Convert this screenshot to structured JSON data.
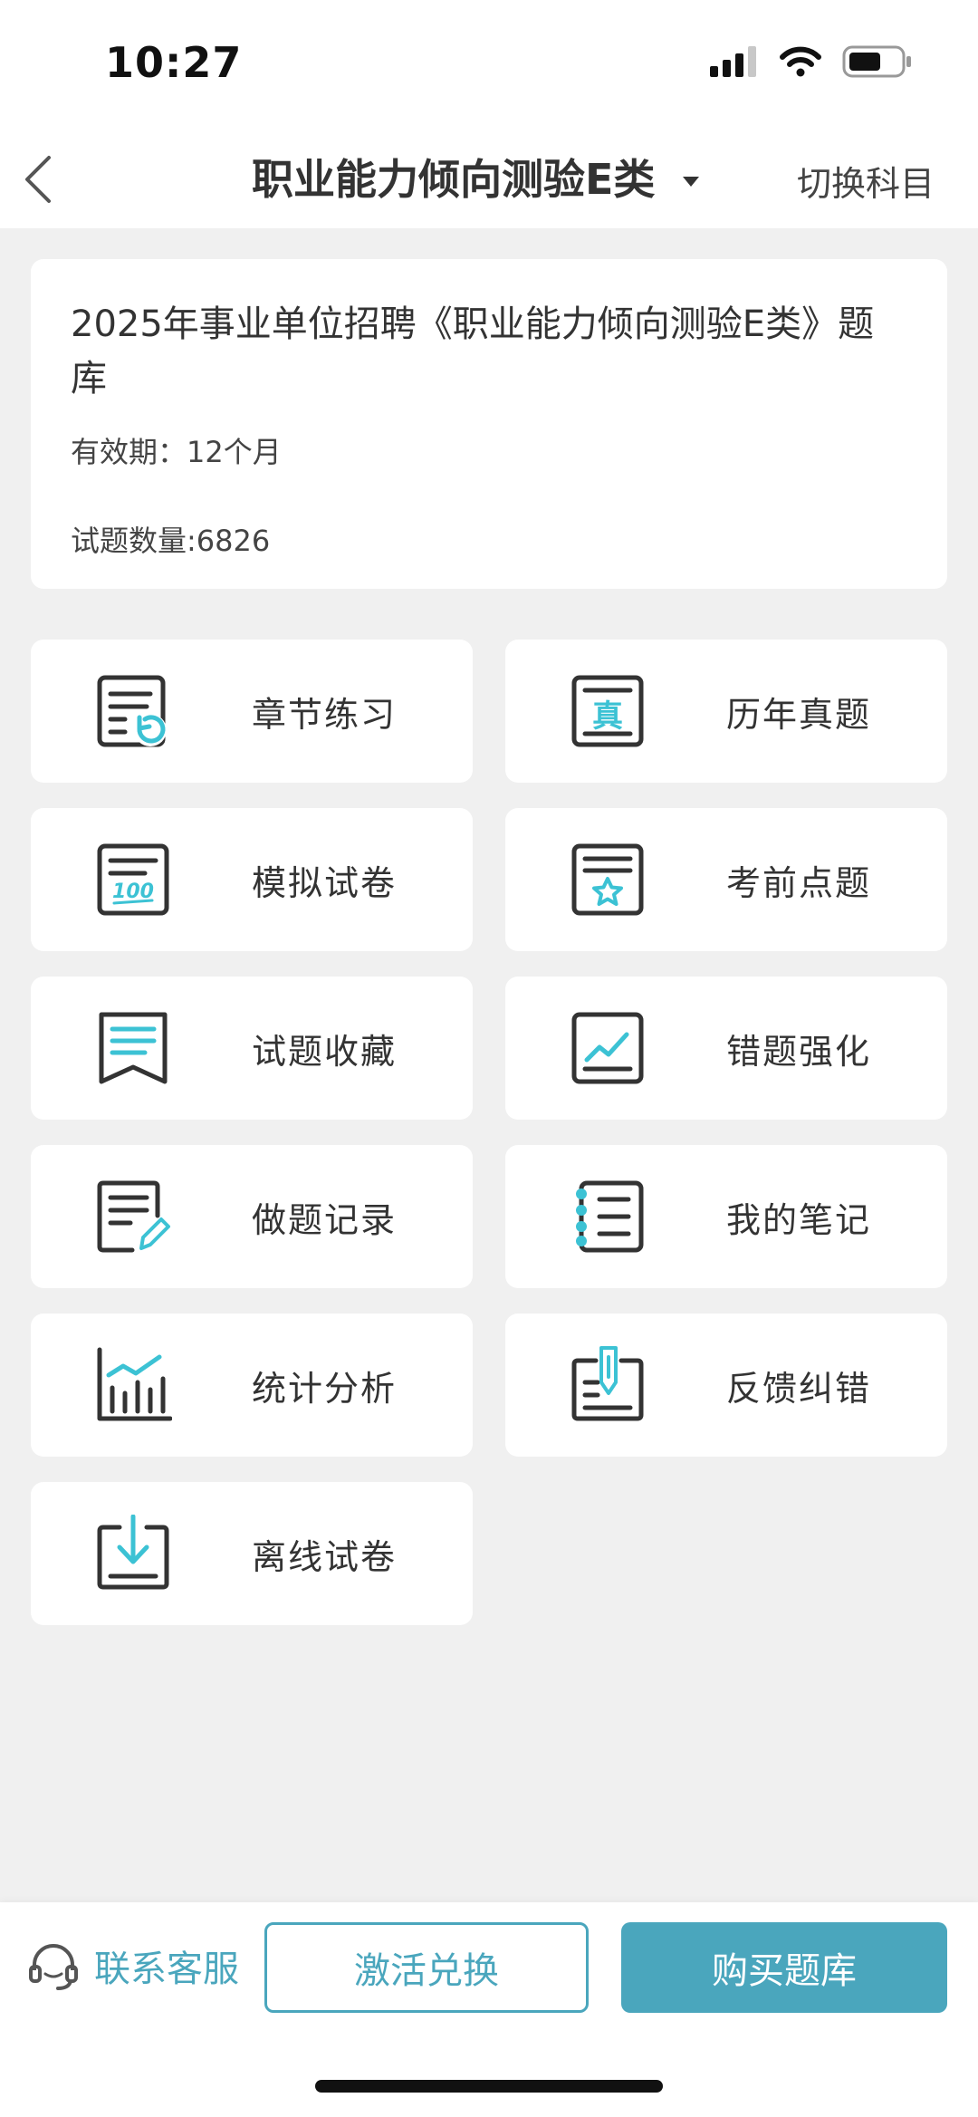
{
  "status_bar": {
    "time": "10:27",
    "icons": [
      "cellular-signal-icon",
      "wifi-icon",
      "battery-icon"
    ]
  },
  "nav": {
    "title": "职业能力倾向测验E类",
    "switch_label": "切换科目",
    "icons": [
      "back-chevron-icon",
      "caret-down-icon"
    ]
  },
  "info": {
    "title": "2025年事业单位招聘《职业能力倾向测验E类》题库",
    "validity": "有效期：12个月",
    "count": "试题数量:6826"
  },
  "tiles": [
    {
      "label": "章节练习",
      "icon": "chapter-practice-icon"
    },
    {
      "label": "历年真题",
      "icon": "past-exam-icon"
    },
    {
      "label": "模拟试卷",
      "icon": "mock-exam-icon"
    },
    {
      "label": "考前点题",
      "icon": "key-points-star-icon"
    },
    {
      "label": "试题收藏",
      "icon": "bookmark-icon"
    },
    {
      "label": "错题强化",
      "icon": "wrong-answers-chart-icon"
    },
    {
      "label": "做题记录",
      "icon": "records-pencil-icon"
    },
    {
      "label": "我的笔记",
      "icon": "notebook-icon"
    },
    {
      "label": "统计分析",
      "icon": "statistics-chart-icon"
    },
    {
      "label": "反馈纠错",
      "icon": "feedback-icon"
    },
    {
      "label": "离线试卷",
      "icon": "download-icon"
    }
  ],
  "bottom": {
    "service_label": "联系客服",
    "activate_label": "激活兑换",
    "buy_label": "购买题库",
    "service_icon": "headset-icon"
  },
  "colors": {
    "accent": "#4aa6bd",
    "icon_dark": "#333333",
    "icon_accent": "#3cc2d4",
    "background": "#f0f0f0"
  }
}
